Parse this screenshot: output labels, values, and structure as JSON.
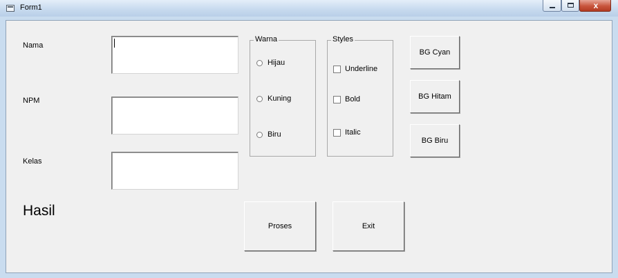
{
  "window": {
    "title": "Form1",
    "min_glyph": "",
    "close_glyph": "x"
  },
  "form": {
    "labels": {
      "nama": "Nama",
      "npm": "NPM",
      "kelas": "Kelas"
    },
    "inputs": {
      "nama": {
        "value": "",
        "placeholder": ""
      },
      "npm": {
        "value": "",
        "placeholder": ""
      },
      "kelas": {
        "value": "",
        "placeholder": ""
      }
    },
    "hasil": "Hasil"
  },
  "warna": {
    "title": "Warna",
    "options": [
      "Hijau",
      "Kuning",
      "Biru"
    ]
  },
  "styles": {
    "title": "Styles",
    "options": [
      "Underline",
      "Bold",
      "Italic"
    ]
  },
  "buttons": {
    "bg_cyan": "BG Cyan",
    "bg_hitam": "BG Hitam",
    "bg_biru": "BG Biru",
    "proses": "Proses",
    "exit": "Exit"
  }
}
